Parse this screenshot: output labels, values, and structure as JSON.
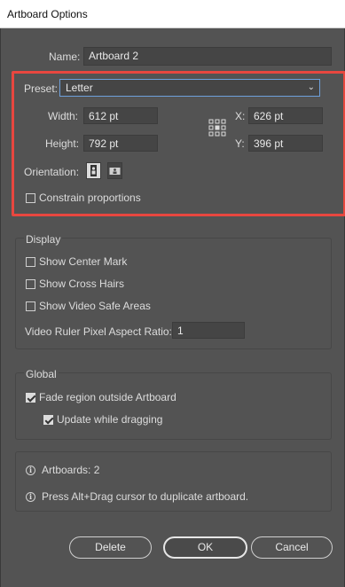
{
  "window": {
    "title": "Artboard Options"
  },
  "name": {
    "label": "Name:",
    "value": "Artboard 2"
  },
  "preset": {
    "label": "Preset:",
    "value": "Letter"
  },
  "width": {
    "label": "Width:",
    "value": "612 pt"
  },
  "height": {
    "label": "Height:",
    "value": "792 pt"
  },
  "x": {
    "label": "X:",
    "value": "626 pt"
  },
  "y": {
    "label": "Y:",
    "value": "396 pt"
  },
  "orientation": {
    "label": "Orientation:",
    "selected": "portrait"
  },
  "constrain": {
    "label": "Constrain proportions",
    "checked": false
  },
  "display": {
    "title": "Display",
    "show_center_mark": {
      "label": "Show Center Mark",
      "checked": false
    },
    "show_cross_hairs": {
      "label": "Show Cross Hairs",
      "checked": false
    },
    "show_video_safe": {
      "label": "Show Video Safe Areas",
      "checked": false
    },
    "pixel_ratio": {
      "label": "Video Ruler Pixel Aspect Ratio:",
      "value": "1"
    }
  },
  "global": {
    "title": "Global",
    "fade_region": {
      "label": "Fade region outside Artboard",
      "checked": true
    },
    "update_dragging": {
      "label": "Update while dragging",
      "checked": true
    }
  },
  "info": {
    "artboards": "Artboards: 2",
    "hint": "Press Alt+Drag cursor to duplicate artboard."
  },
  "buttons": {
    "delete": "Delete",
    "ok": "OK",
    "cancel": "Cancel"
  },
  "colors": {
    "accent_highlight": "#e8473f",
    "focus_border": "#6ea0db",
    "bg": "#535353"
  }
}
